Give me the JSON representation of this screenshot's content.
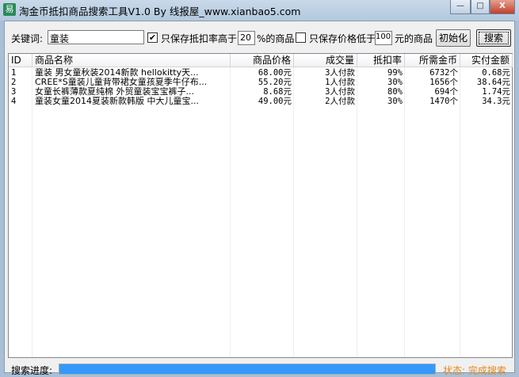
{
  "window": {
    "title": "淘金币抵扣商品搜索工具V1.0 By 线报屋_www.xianbao5.com",
    "minimize": "—",
    "maximize": "□",
    "close": "X"
  },
  "toolbar": {
    "keyword_label": "关键词:",
    "keyword_value": "童装",
    "rate_filter_checked": true,
    "rate_filter_label": "只保存抵扣率高于",
    "rate_value": "20",
    "rate_suffix": "%的商品",
    "price_filter_checked": false,
    "price_filter_label": "只保存价格低于",
    "price_value": "100",
    "price_suffix": "元的商品",
    "init_button": "初始化",
    "search_button": "搜索"
  },
  "table": {
    "columns": [
      "ID",
      "商品名称",
      "商品价格",
      "成交量",
      "抵扣率",
      "所需金币",
      "实付金额"
    ],
    "rows": [
      [
        "1",
        "童装 男女童秋装2014新款 hellokitty天...",
        "68.00元",
        "3人付款",
        "99%",
        "6732个",
        "0.68元"
      ],
      [
        "2",
        "CREE*S童装儿童背带裙女童孩夏季牛仔布...",
        "55.20元",
        "1人付款",
        "30%",
        "1656个",
        "38.64元"
      ],
      [
        "3",
        "女童长裤薄款夏纯棉 外贸童装宝宝裤子...",
        "8.68元",
        "3人付款",
        "80%",
        "694个",
        "1.74元"
      ],
      [
        "4",
        "童装女童2014夏装新款韩版 中大儿童宝...",
        "49.00元",
        "2人付款",
        "30%",
        "1470个",
        "34.3元"
      ]
    ]
  },
  "footer": {
    "progress_label": "搜索进度:",
    "progress_percent": 100,
    "status": "状态: 完成搜索",
    "status_color": "#e08a1e",
    "progress_color": "#3399ff"
  }
}
